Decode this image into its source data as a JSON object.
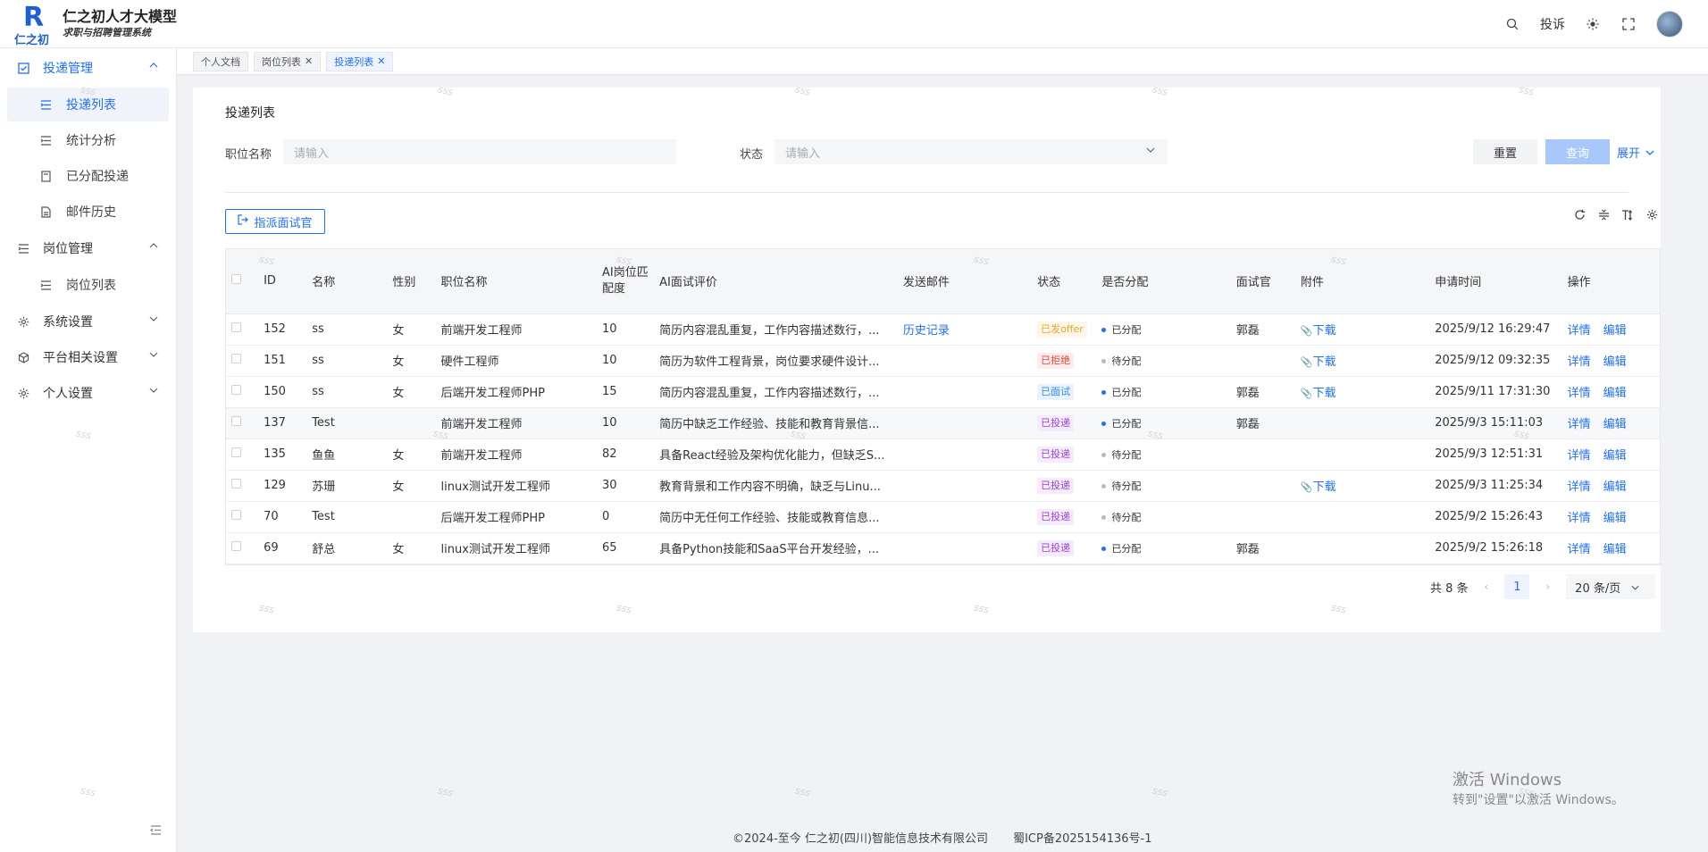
{
  "app": {
    "logo_mark": "R",
    "logo_cn": "仁之初",
    "title": "仁之初人才大模型",
    "subtitle": "求职与招聘管理系统"
  },
  "header": {
    "complaint_label": "投诉",
    "icons": [
      "search-icon",
      "sun-icon",
      "fullscreen-icon",
      "avatar"
    ]
  },
  "sidebar": {
    "groups": [
      {
        "label": "投递管理",
        "icon": "checkbox-icon",
        "expanded": true,
        "items": [
          {
            "label": "投递列表",
            "icon": "list-icon",
            "active": true
          },
          {
            "label": "统计分析",
            "icon": "list-icon"
          },
          {
            "label": "已分配投递",
            "icon": "doc-icon"
          },
          {
            "label": "邮件历史",
            "icon": "doc-icon"
          }
        ]
      },
      {
        "label": "岗位管理",
        "icon": "list-icon",
        "expanded": true,
        "items": [
          {
            "label": "岗位列表",
            "icon": "list-icon"
          }
        ]
      },
      {
        "label": "系统设置",
        "icon": "gear-icon",
        "expanded": false
      },
      {
        "label": "平台相关设置",
        "icon": "cube-icon",
        "expanded": false
      },
      {
        "label": "个人设置",
        "icon": "gear-icon",
        "expanded": false
      }
    ]
  },
  "tabs": [
    {
      "label": "个人文档",
      "closable": false,
      "active": false
    },
    {
      "label": "岗位列表",
      "closable": true,
      "active": false
    },
    {
      "label": "投递列表",
      "closable": true,
      "active": true
    }
  ],
  "page": {
    "title": "投递列表",
    "filters": {
      "position_label": "职位名称",
      "position_placeholder": "请输入",
      "status_label": "状态",
      "status_placeholder": "请输入"
    },
    "reset_label": "重置",
    "query_label": "查询",
    "expand_label": "展开",
    "assign_label": "指派面试官"
  },
  "table": {
    "columns": [
      "ID",
      "名称",
      "性别",
      "职位名称",
      "AI岗位匹配度",
      "AI面试评价",
      "发送邮件",
      "状态",
      "是否分配",
      "面试官",
      "附件",
      "申请时间",
      "操作"
    ],
    "rows": [
      {
        "id": "152",
        "name": "ss",
        "gender": "女",
        "position": "前端开发工程师",
        "match": "10",
        "eval": "简历内容混乱重复，工作内容描述数行，...",
        "email": "历史记录",
        "status": "已发offer",
        "status_color": "#e8a33d",
        "status_bg": "#fff7e6",
        "assigned": "已分配",
        "assigned_color": "#1f6fff",
        "interviewer": "郭磊",
        "attachment": "下载",
        "time": "2025/9/12 16:29:47",
        "ops": [
          "详情",
          "编辑"
        ]
      },
      {
        "id": "151",
        "name": "ss",
        "gender": "女",
        "position": "硬件工程师",
        "match": "10",
        "eval": "简历为软件工程背景，岗位要求硬件设计...",
        "email": "",
        "status": "已拒绝",
        "status_color": "#e0483a",
        "status_bg": "#fdeceb",
        "assigned": "待分配",
        "assigned_color": "#bbbbbb",
        "interviewer": "",
        "attachment": "下载",
        "time": "2025/9/12 09:32:35",
        "ops": [
          "详情",
          "编辑"
        ]
      },
      {
        "id": "150",
        "name": "ss",
        "gender": "女",
        "position": "后端开发工程师PHP",
        "match": "15",
        "eval": "简历内容混乱重复，工作内容描述数行，...",
        "email": "",
        "status": "已面试",
        "status_color": "#2f8cf0",
        "status_bg": "#e8f3ff",
        "assigned": "已分配",
        "assigned_color": "#1f6fff",
        "interviewer": "郭磊",
        "attachment": "下载",
        "time": "2025/9/11 17:31:30",
        "ops": [
          "详情",
          "编辑"
        ]
      },
      {
        "id": "137",
        "name": "Test",
        "gender": "",
        "position": "前端开发工程师",
        "match": "10",
        "eval": "简历中缺乏工作经验、技能和教育背景信...",
        "email": "",
        "status": "已投递",
        "status_color": "#9b43d6",
        "status_bg": "#f5ebfc",
        "assigned": "已分配",
        "assigned_color": "#1f6fff",
        "interviewer": "郭磊",
        "attachment": "",
        "time": "2025/9/3 15:11:03",
        "ops": [
          "详情",
          "编辑"
        ]
      },
      {
        "id": "135",
        "name": "鱼鱼",
        "gender": "女",
        "position": "前端开发工程师",
        "match": "82",
        "eval": "具备React经验及架构优化能力，但缺乏S...",
        "email": "",
        "status": "已投递",
        "status_color": "#9b43d6",
        "status_bg": "#f5ebfc",
        "assigned": "待分配",
        "assigned_color": "#bbbbbb",
        "interviewer": "",
        "attachment": "",
        "time": "2025/9/3 12:51:31",
        "ops": [
          "详情",
          "编辑"
        ]
      },
      {
        "id": "129",
        "name": "苏珊",
        "gender": "女",
        "position": "linux测试开发工程师",
        "match": "30",
        "eval": "教育背景和工作内容不明确，缺乏与Linu...",
        "email": "",
        "status": "已投递",
        "status_color": "#9b43d6",
        "status_bg": "#f5ebfc",
        "assigned": "待分配",
        "assigned_color": "#bbbbbb",
        "interviewer": "",
        "attachment": "下载",
        "time": "2025/9/3 11:25:34",
        "ops": [
          "详情",
          "编辑"
        ]
      },
      {
        "id": "70",
        "name": "Test",
        "gender": "",
        "position": "后端开发工程师PHP",
        "match": "0",
        "eval": "简历中无任何工作经验、技能或教育信息...",
        "email": "",
        "status": "已投递",
        "status_color": "#9b43d6",
        "status_bg": "#f5ebfc",
        "assigned": "待分配",
        "assigned_color": "#bbbbbb",
        "interviewer": "",
        "attachment": "",
        "time": "2025/9/2 15:26:43",
        "ops": [
          "详情",
          "编辑"
        ]
      },
      {
        "id": "69",
        "name": "舒总",
        "gender": "女",
        "position": "linux测试开发工程师",
        "match": "65",
        "eval": "具备Python技能和SaaS平台开发经验，...",
        "email": "",
        "status": "已投递",
        "status_color": "#9b43d6",
        "status_bg": "#f5ebfc",
        "assigned": "已分配",
        "assigned_color": "#1f6fff",
        "interviewer": "郭磊",
        "attachment": "",
        "time": "2025/9/2 15:26:18",
        "ops": [
          "详情",
          "编辑"
        ]
      }
    ]
  },
  "pagination": {
    "total_label": "共 8 条",
    "current_page": "1",
    "page_size_label": "20 条/页"
  },
  "footer": {
    "copyright": "©2024-至今 仁之初(四川)智能信息技术有限公司",
    "icp": "蜀ICP备2025154136号-1"
  },
  "windows_activation": {
    "line1": "激活 Windows",
    "line2": "转到\"设置\"以激活 Windows。"
  },
  "watermark_text": "sss"
}
